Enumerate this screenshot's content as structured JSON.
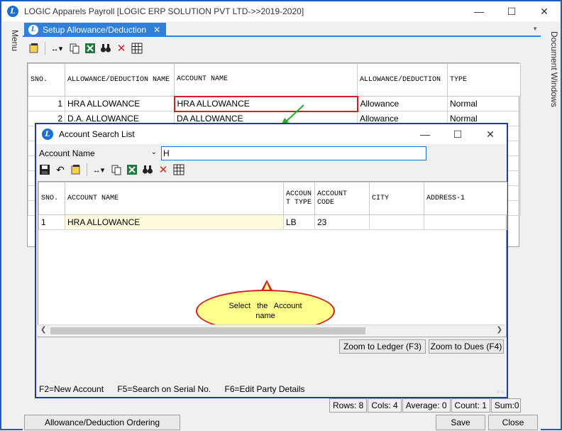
{
  "app": {
    "title": "LOGIC Apparels Payroll  [LOGIC ERP SOLUTION PVT LTD->>2019-2020]",
    "logo_letter": "L",
    "side_menu_label": "Menu",
    "side_docs_label": "Document Windows"
  },
  "tab": {
    "label": "Setup Allowance/Deduction",
    "close": "✕"
  },
  "grid": {
    "headers": [
      "SNO.",
      "ALLOWANCE/DEDUCTION NAME",
      "ACCOUNT NAME",
      "ALLOWANCE/DEDUCTION",
      "TYPE"
    ],
    "rows": [
      {
        "sno": "1",
        "name": "HRA ALLOWANCE",
        "account": "HRA ALLOWANCE",
        "kind": "Allowance",
        "type": "Normal"
      },
      {
        "sno": "2",
        "name": "D.A. ALLOWANCE",
        "account": "DA ALLOWANCE",
        "kind": "Allowance",
        "type": "Normal"
      }
    ]
  },
  "status": {
    "rows": "Rows: 8",
    "cols": "Cols: 4",
    "average": "Average: 0",
    "count": "Count: 1",
    "sum": "Sum:0"
  },
  "buttons": {
    "ordering": "Allowance/Deduction Ordering",
    "save": "Save",
    "close": "Close"
  },
  "dialog": {
    "title": "Account Search List",
    "search_field": "Account Name",
    "search_value": "H",
    "headers": [
      "SNO.",
      "ACCOUNT NAME",
      "ACCOUNT TYPE",
      "ACCOUNT CODE",
      "CITY",
      "ADDRESS-1"
    ],
    "rows": [
      {
        "sno": "1",
        "name": "HRA ALLOWANCE",
        "type": "LB",
        "code": "23",
        "city": "",
        "address": ""
      }
    ],
    "callout": "Select the Account name",
    "zoom_ledger": "Zoom to Ledger (F3)",
    "zoom_dues": "Zoom to Dues (F4)",
    "footer": {
      "f2": "F2=New Account",
      "f5": "F5=Search on Serial No.",
      "f6": "F6=Edit Party Details"
    }
  },
  "colors": {
    "accent": "#2f7fdc",
    "window_border": "#1d38b8",
    "selection_border": "#d42020",
    "callout_fill": "#ffff8c",
    "highlight_cell": "#fffbdc"
  }
}
